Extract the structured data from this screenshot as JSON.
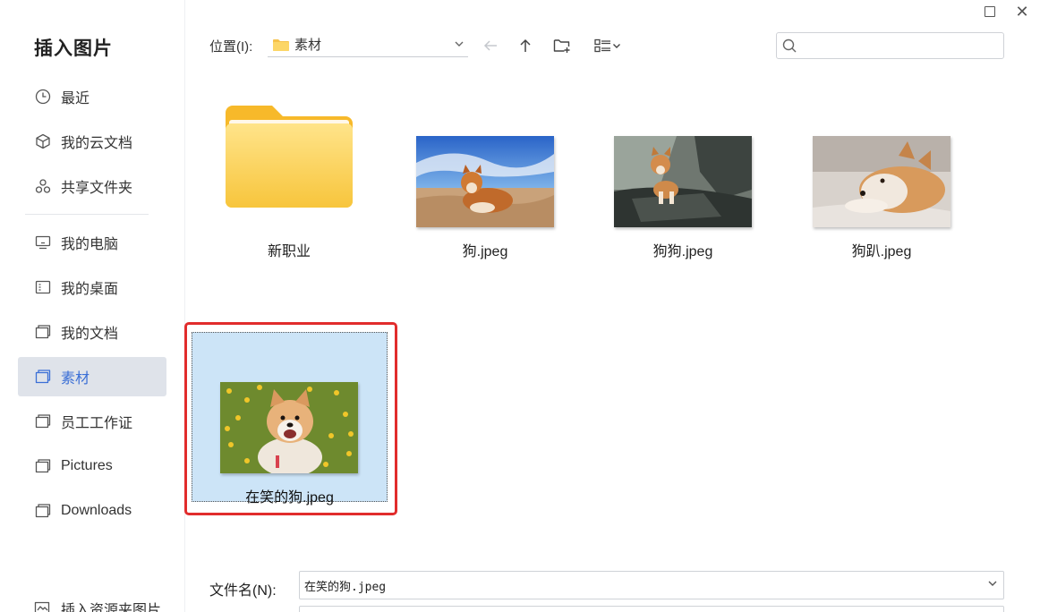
{
  "dialog": {
    "title": "插入图片"
  },
  "sidebar": {
    "items": [
      {
        "label": "最近",
        "icon": "clock-icon"
      },
      {
        "label": "我的云文档",
        "icon": "cube-icon"
      },
      {
        "label": "共享文件夹",
        "icon": "share-icon"
      },
      {
        "label": "我的电脑",
        "icon": "computer-icon"
      },
      {
        "label": "我的桌面",
        "icon": "desktop-icon"
      },
      {
        "label": "我的文档",
        "icon": "folder-icon"
      },
      {
        "label": "素材",
        "icon": "folder-icon",
        "active": true
      },
      {
        "label": "员工工作证",
        "icon": "folder-icon"
      },
      {
        "label": "Pictures",
        "icon": "folder-icon"
      },
      {
        "label": "Downloads",
        "icon": "folder-icon"
      }
    ],
    "bottom_link": "插入资源夹图片"
  },
  "toolbar": {
    "location_label": "位置(I):",
    "location_value": "素材",
    "search_placeholder": ""
  },
  "files": [
    {
      "name": "新职业",
      "type": "folder"
    },
    {
      "name": "狗.jpeg",
      "type": "image"
    },
    {
      "name": "狗狗.jpeg",
      "type": "image"
    },
    {
      "name": "狗趴.jpeg",
      "type": "image"
    },
    {
      "name": "在笑的狗.jpeg",
      "type": "image",
      "selected": true
    }
  ],
  "bottom": {
    "filename_label": "文件名(N):",
    "filename_value": "在笑的狗.jpeg"
  },
  "colors": {
    "accent": "#3b6fd6",
    "selection": "#cce4f7",
    "highlight": "#e12c2c"
  }
}
